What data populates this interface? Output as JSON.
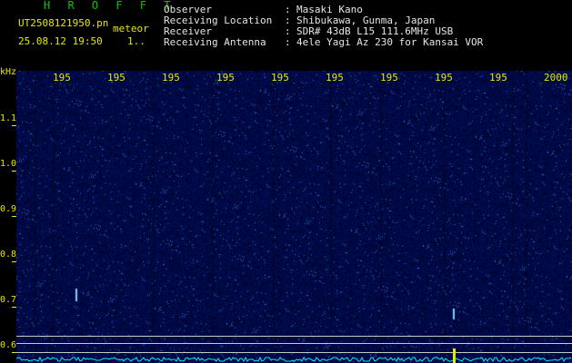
{
  "header": {
    "brand": "H R O F F T",
    "filename": "UT2508121950.pn",
    "tag": "meteor",
    "datetime": "25.08.12 19:50",
    "index": "1..",
    "meta": [
      {
        "label": "Observer",
        "sep": ":",
        "value": "Masaki Kano"
      },
      {
        "label": "Receiving Location",
        "sep": ":",
        "value": "Shibukawa, Gunma, Japan"
      },
      {
        "label": "Receiver",
        "sep": ":",
        "value": "SDR# 43dB L15 111.6MHz USB"
      },
      {
        "label": "Receiving Antenna",
        "sep": ":",
        "value": "4ele Yagi Az 230 for Kansai VOR"
      }
    ]
  },
  "axis": {
    "y_unit": "kHz",
    "y_ticks": [
      "1.1",
      "1.0",
      "0.9",
      "0.8",
      "0.7",
      "0.6"
    ],
    "x_ticks": [
      "195",
      "195",
      "195",
      "195",
      "195",
      "195",
      "195",
      "195",
      "195",
      "2000"
    ]
  },
  "colors": {
    "background": "#04043a",
    "label": "#e8e800",
    "trace": "#00e8ff",
    "brand": "#00c800"
  }
}
